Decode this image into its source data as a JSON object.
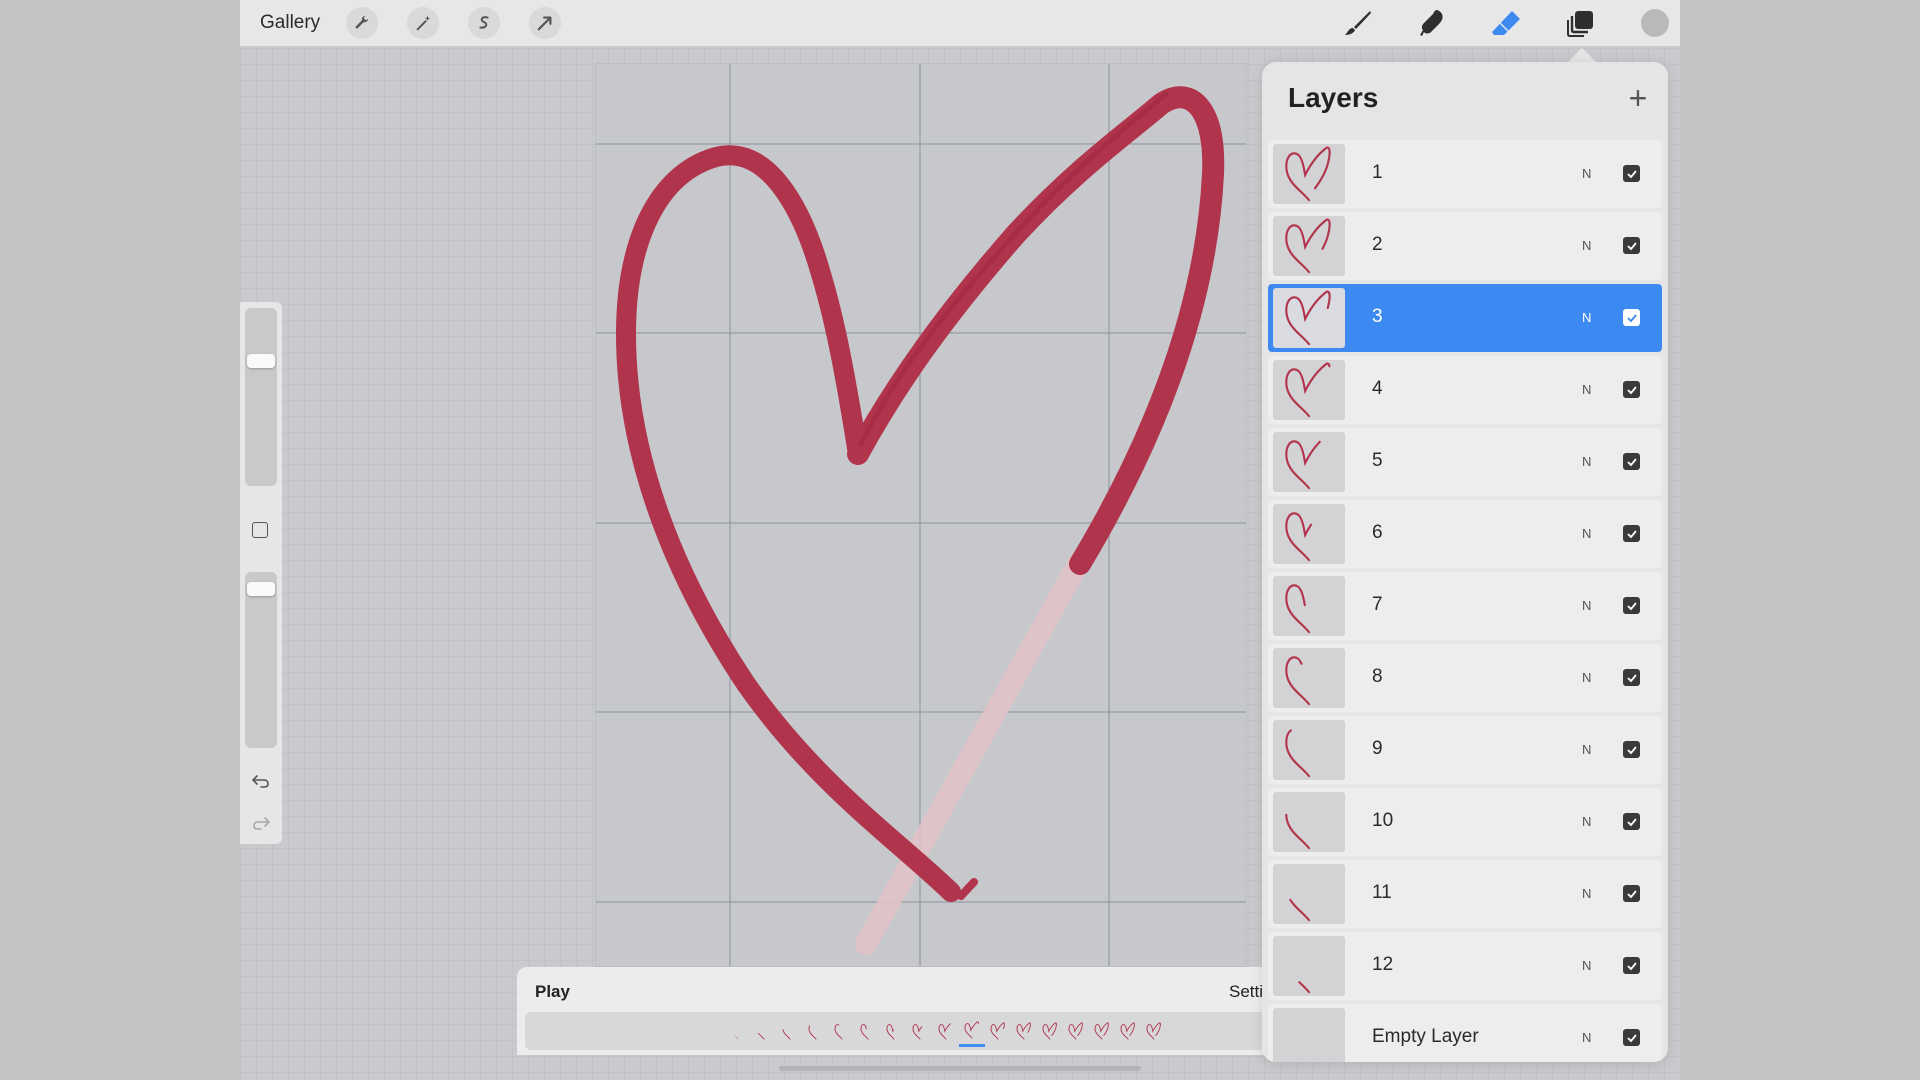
{
  "topbar": {
    "gallery_label": "Gallery",
    "tools_left": [
      "wrench-icon",
      "magic-wand-icon",
      "selection-icon",
      "transform-arrow-icon"
    ],
    "tools_right": [
      "brush-icon",
      "smudge-icon",
      "eraser-icon",
      "layers-icon",
      "color-icon"
    ],
    "active_tool": "eraser-icon",
    "accent_color": "#3d89f2"
  },
  "canvas": {
    "stroke_color": "#b1344d",
    "onion_skin_color": "#e2c3c9"
  },
  "sidebar": {
    "brush_size_level": 0.28,
    "opacity_level": 0.06
  },
  "animation": {
    "play_label": "Play",
    "settings_label": "Settings",
    "frame_count": 17,
    "current_frame": 10
  },
  "layers": {
    "title": "Layers",
    "add_label": "+",
    "items": [
      {
        "name": "1",
        "blend": "N",
        "visible": true
      },
      {
        "name": "2",
        "blend": "N",
        "visible": true
      },
      {
        "name": "3",
        "blend": "N",
        "visible": true,
        "selected": true
      },
      {
        "name": "4",
        "blend": "N",
        "visible": true
      },
      {
        "name": "5",
        "blend": "N",
        "visible": true
      },
      {
        "name": "6",
        "blend": "N",
        "visible": true
      },
      {
        "name": "7",
        "blend": "N",
        "visible": true
      },
      {
        "name": "8",
        "blend": "N",
        "visible": true
      },
      {
        "name": "9",
        "blend": "N",
        "visible": true
      },
      {
        "name": "10",
        "blend": "N",
        "visible": true
      },
      {
        "name": "11",
        "blend": "N",
        "visible": true
      },
      {
        "name": "12",
        "blend": "N",
        "visible": true
      },
      {
        "name": "Empty Layer",
        "blend": "N",
        "visible": true
      }
    ]
  }
}
